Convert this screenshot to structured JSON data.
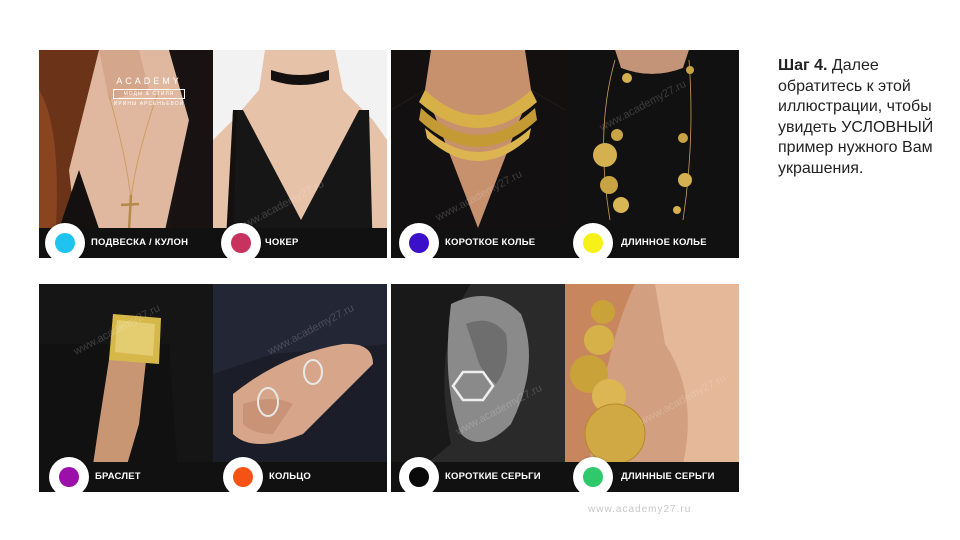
{
  "brand": {
    "name": "ACADEMY",
    "line1": "МОДЫ & СТИЛЯ",
    "line2": "ИРИНЫ АРСЕНЬЕВОЙ"
  },
  "watermark": "www.academy27.ru",
  "panels": [
    {
      "cells": [
        {
          "label": "ПОДВЕСКА / КУЛОН",
          "dot_color": "#1ec3f0"
        },
        {
          "label": "ЧОКЕР",
          "dot_color": "#c7325f"
        }
      ]
    },
    {
      "cells": [
        {
          "label": "КОРОТКОЕ КОЛЬЕ",
          "dot_color": "#3a10c8"
        },
        {
          "label": "ДЛИННОЕ КОЛЬЕ",
          "dot_color": "#f6f218"
        }
      ]
    },
    {
      "cells": [
        {
          "label": "БРАСЛЕТ",
          "dot_color": "#9a10a8"
        },
        {
          "label": "КОЛЬЦО",
          "dot_color": "#f55314"
        }
      ]
    },
    {
      "cells": [
        {
          "label": "КОРОТКИЕ СЕРЬГИ",
          "dot_color": "#0a0a0a"
        },
        {
          "label": "ДЛИННЫЕ СЕРЬГИ",
          "dot_color": "#2fc86a"
        }
      ]
    }
  ],
  "instruction": {
    "step": "Шаг 4.",
    "text": " Далее обратитесь к этой иллюстрации, чтобы увидеть УСЛОВНЫЙ пример нужного Вам украшения."
  }
}
